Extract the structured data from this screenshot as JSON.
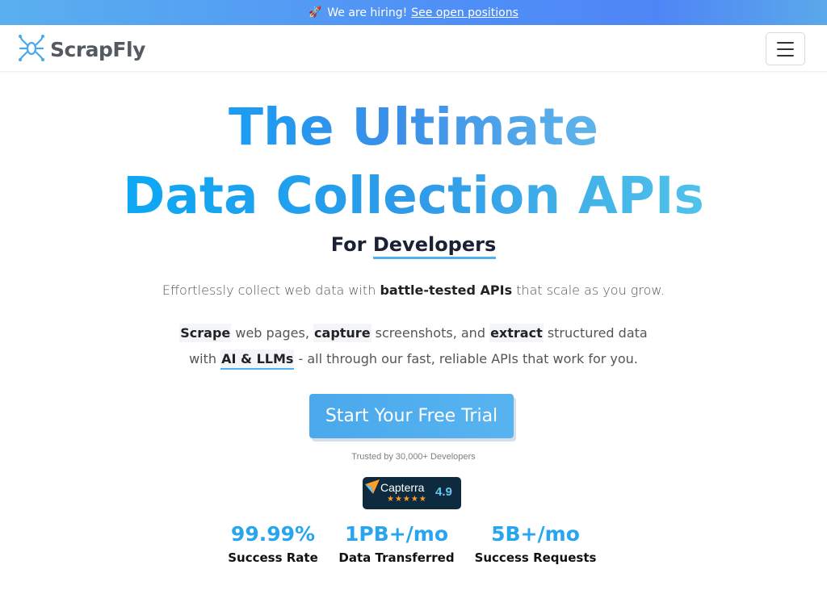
{
  "banner": {
    "text": "We are hiring!",
    "link": "See open positions",
    "icon": "rocket-icon"
  },
  "nav": {
    "logo_text": "ScrapFly",
    "logo_icon": "spider-icon",
    "menu_icon": "hamburger-icon"
  },
  "hero": {
    "title_line1": "The Ultimate",
    "title_line2": "Data Collection APIs",
    "for_prefix": "For",
    "for_highlight": "Developers"
  },
  "tagline": {
    "pre": "Effortlessly collect web data with",
    "bold": "battle-tested APIs",
    "post": "that scale as you grow."
  },
  "description": {
    "w1": "Scrape",
    "t1": "web pages,",
    "w2": "capture",
    "t2": "screenshots, and",
    "w3": "extract",
    "t3": "structured data",
    "t4": "with",
    "w4": "AI & LLMs",
    "t5": "- all through our fast, reliable APIs that work for you."
  },
  "cta": {
    "label": "Start Your Free Trial",
    "trusted": "Trusted by 30,000+ Developers"
  },
  "capterra": {
    "name": "Capterra",
    "stars": "★★★★★",
    "score": "4.9"
  },
  "stats": [
    {
      "value": "99.99%",
      "label": "Success Rate"
    },
    {
      "value": "1PB+/mo",
      "label": "Data Transferred"
    },
    {
      "value": "5B+/mo",
      "label": "Success Requests"
    }
  ]
}
